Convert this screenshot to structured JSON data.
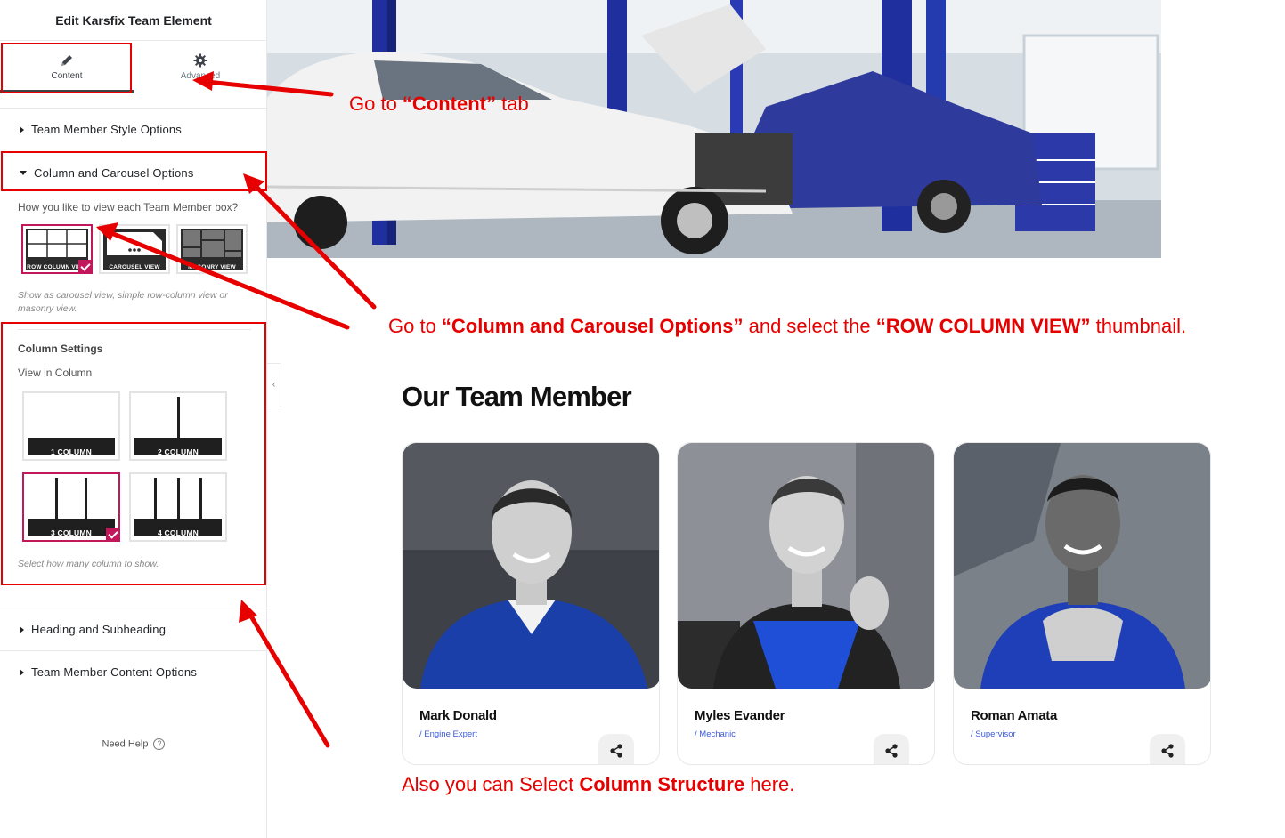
{
  "panel": {
    "title": "Edit Karsfix Team Element",
    "tabs": [
      {
        "label": "Content",
        "icon": "pencil-icon",
        "active": true
      },
      {
        "label": "Advanced",
        "icon": "gear-icon",
        "active": false
      }
    ],
    "sections": {
      "style_options": "Team Member Style Options",
      "column_carousel": "Column and Carousel Options",
      "heading_subheading": "Heading and Subheading",
      "content_options": "Team Member Content Options"
    },
    "view_question": "How you like to view each Team Member box?",
    "view_options": [
      {
        "label": "ROW COLUMN VIEW",
        "selected": true
      },
      {
        "label": "CAROUSEL VIEW",
        "selected": false
      },
      {
        "label": "MASONRY VIEW",
        "selected": false
      }
    ],
    "view_note": "Show as carousel view, simple row-column view or masonry view.",
    "column_settings_title": "Column Settings",
    "view_in_column_label": "View in Column",
    "column_options": [
      {
        "label": "1 COLUMN",
        "cells": 1,
        "selected": false
      },
      {
        "label": "2 COLUMN",
        "cells": 2,
        "selected": false
      },
      {
        "label": "3 COLUMN",
        "cells": 3,
        "selected": true
      },
      {
        "label": "4 COLUMN",
        "cells": 4,
        "selected": false
      }
    ],
    "column_note": "Select how many column to show.",
    "need_help": "Need Help",
    "collapse_icon": "chevron-left-icon"
  },
  "preview": {
    "section_heading": "Our Team Member",
    "members": [
      {
        "name": "Mark Donald",
        "role": "/ Engine Expert"
      },
      {
        "name": "Myles Evander",
        "role": "/ Mechanic"
      },
      {
        "name": "Roman Amata",
        "role": "/ Supervisor"
      }
    ],
    "share_icon": "share-icon"
  },
  "annotations": {
    "content_tab": {
      "prefix": "Go  to ",
      "bold": "“Content”",
      "suffix": " tab"
    },
    "column_carousel": {
      "p1": "Go to ",
      "b1": "“Column and Carousel Options”",
      "p2": " and select the ",
      "b2": "“ROW COLUMN VIEW”",
      "p3": " thumbnail."
    },
    "column_structure": {
      "prefix": "Also you can Select ",
      "bold": "Column Structure",
      "suffix": " here."
    }
  },
  "colors": {
    "accent": "#c2185b",
    "annotation_red": "#e60000",
    "role_blue": "#3b5bdb"
  }
}
